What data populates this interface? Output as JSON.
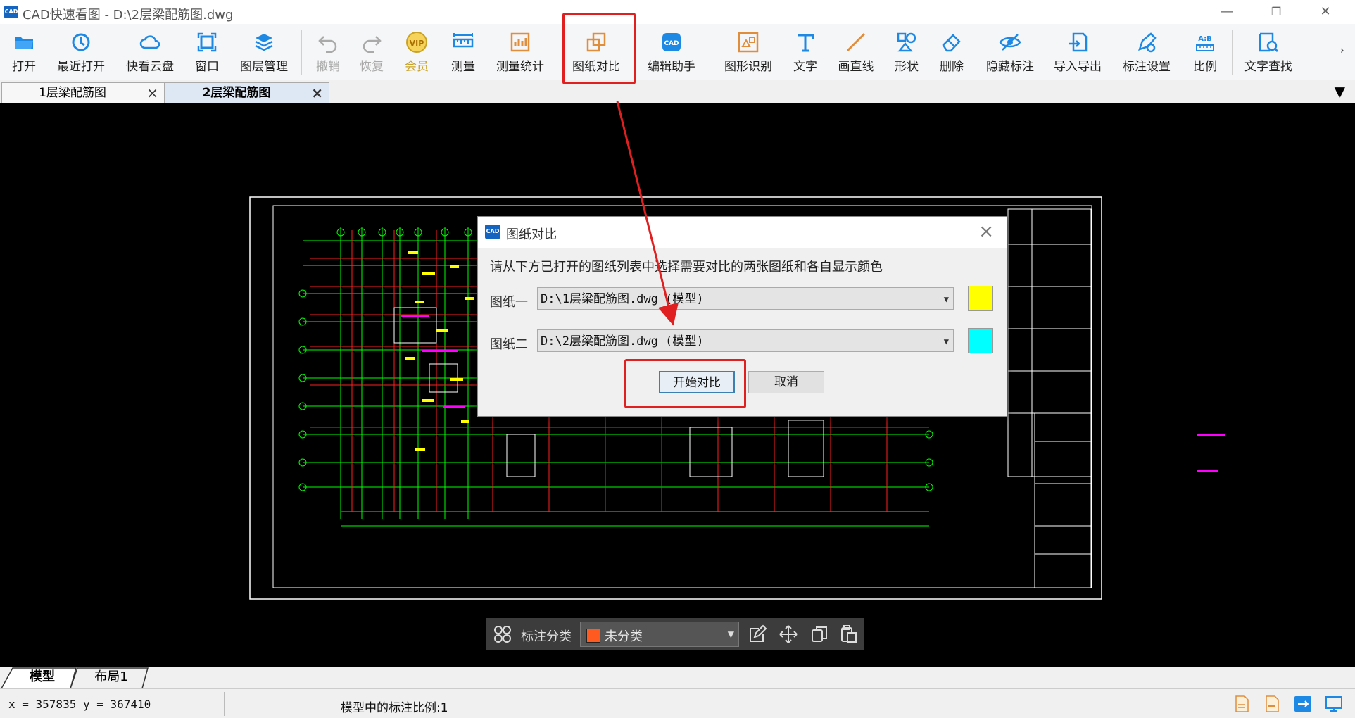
{
  "window": {
    "title": "CAD快速看图 - D:\\2层梁配筋图.dwg",
    "logo_text": "CAD"
  },
  "toolbar": {
    "items": [
      {
        "label": "打开",
        "icon": "open-folder-icon"
      },
      {
        "label": "最近打开",
        "icon": "recent-icon"
      },
      {
        "label": "快看云盘",
        "icon": "cloud-icon"
      },
      {
        "label": "窗口",
        "icon": "window-icon"
      },
      {
        "label": "图层管理",
        "icon": "layers-icon"
      },
      {
        "label": "撤销",
        "icon": "undo-icon"
      },
      {
        "label": "恢复",
        "icon": "redo-icon"
      },
      {
        "label": "会员",
        "icon": "vip-icon"
      },
      {
        "label": "测量",
        "icon": "ruler-icon"
      },
      {
        "label": "测量统计",
        "icon": "measure-stats-icon"
      },
      {
        "label": "图纸对比",
        "icon": "compare-icon"
      },
      {
        "label": "编辑助手",
        "icon": "edit-assistant-icon"
      },
      {
        "label": "图形识别",
        "icon": "shape-recognize-icon"
      },
      {
        "label": "文字",
        "icon": "text-icon"
      },
      {
        "label": "画直线",
        "icon": "line-icon"
      },
      {
        "label": "形状",
        "icon": "shape-icon"
      },
      {
        "label": "删除",
        "icon": "eraser-icon"
      },
      {
        "label": "隐藏标注",
        "icon": "hide-annotation-icon"
      },
      {
        "label": "导入导出",
        "icon": "import-export-icon"
      },
      {
        "label": "标注设置",
        "icon": "annotation-settings-icon"
      },
      {
        "label": "比例",
        "icon": "scale-icon"
      },
      {
        "label": "文字查找",
        "icon": "text-search-icon"
      }
    ],
    "vip_badge": "VIP",
    "edit_badge": "CAD",
    "scale_badge": "A:B"
  },
  "tabs": [
    {
      "label": "1层梁配筋图",
      "active": false
    },
    {
      "label": "2层梁配筋图",
      "active": true
    }
  ],
  "dialog": {
    "title": "图纸对比",
    "instruction": "请从下方已打开的图纸列表中选择需要对比的两张图纸和各自显示颜色",
    "drawing1_label": "图纸一",
    "drawing1_value": "D:\\1层梁配筋图.dwg (模型)",
    "drawing1_color": "#ffff00",
    "drawing2_label": "图纸二",
    "drawing2_value": "D:\\2层梁配筋图.dwg (模型)",
    "drawing2_color": "#00ffff",
    "start_label": "开始对比",
    "cancel_label": "取消"
  },
  "annotation_bar": {
    "label": "标注分类",
    "category": "未分类",
    "category_color": "#ff5a1f"
  },
  "layout_tabs": [
    {
      "label": "模型",
      "active": true
    },
    {
      "label": "布局1",
      "active": false
    }
  ],
  "status": {
    "coords": "x = 357835  y = 367410",
    "scale_text": "模型中的标注比例:1"
  },
  "colors": {
    "highlight": "#e02020",
    "accent": "#1565c0"
  }
}
